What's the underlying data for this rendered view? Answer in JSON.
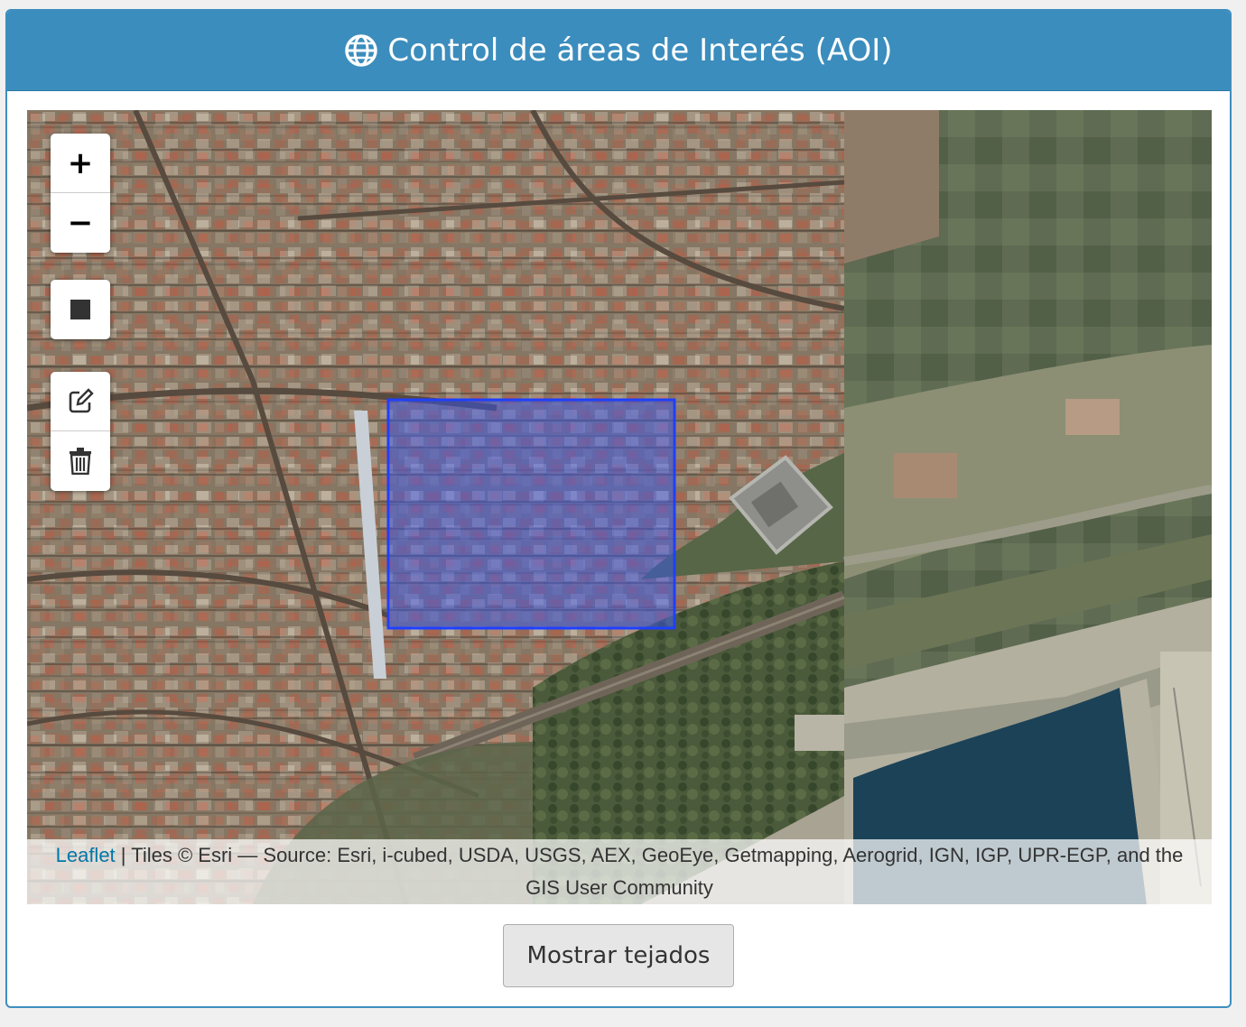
{
  "panel": {
    "title": "Control de áreas de Interés (AOI)",
    "title_icon": "globe-icon"
  },
  "map": {
    "controls": {
      "zoom_in": "+",
      "zoom_out": "−",
      "draw_rectangle_icon": "square-icon",
      "edit_icon": "edit-icon",
      "delete_icon": "trash-icon"
    },
    "aoi_color": "#3355ff",
    "attribution": {
      "link": "Leaflet",
      "text": " | Tiles © Esri — Source: Esri, i-cubed, USDA, USGS, AEX, GeoEye, Getmapping, Aerogrid, IGN, IGP, UPR-EGP, and the GIS User Community"
    }
  },
  "actions": {
    "show_roofs_label": "Mostrar tejados"
  }
}
